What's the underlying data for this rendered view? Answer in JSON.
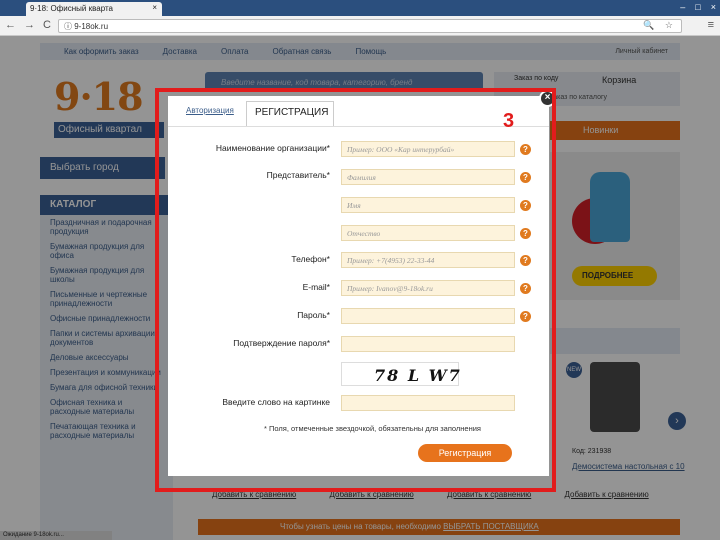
{
  "browser": {
    "tab_title": "9·18: Офисный кварта",
    "tab_close": "×",
    "window_buttons": [
      "–",
      "□",
      "×"
    ],
    "nav_icons": [
      "←",
      "→",
      "C"
    ],
    "url": "ⓘ 9-18ok.ru",
    "url_icons": "🔍 ☆",
    "menu_icon": "≡",
    "status": "Ожидание 9-18ok.ru..."
  },
  "site": {
    "topnav": [
      "Как оформить заказ",
      "Доставка",
      "Оплата",
      "Обратная связь",
      "Помощь"
    ],
    "personal_cabinet": "Личный кабинет",
    "logo": "9·18",
    "logo_sub": "Офисный квартал",
    "search_placeholder": "Введите название, код товара, категорию, бренд",
    "order_by_code": "Заказ по коду",
    "cart": "Корзина",
    "catalog_order": "Заказ по каталогу",
    "new_items": "Новинки",
    "choose_city": "Выбрать город",
    "catalog_title": "КАТАЛОГ",
    "catalog_items": [
      "Праздничная и подарочная продукция",
      "Бумажная продукция для офиса",
      "Бумажная продукция для школы",
      "Письменные и чертежные принадлежности",
      "Офисные принадлежности",
      "Папки и системы архивации документов",
      "Деловые аксессуары",
      "Презентация и коммуникации",
      "Бумага для офисной техники",
      "Офисная техника и расходные материалы",
      "Печатающая техника и расходные материалы"
    ],
    "more_button": "ПОДРОБНЕЕ",
    "new_badge": "NEW",
    "next_arrow": "›",
    "product_code": "Код: 231938",
    "product_name": "Демосистема настольная с 10",
    "compare_links": [
      "Добавить к сравнению",
      "Добавить к сравнению",
      "Добавить к сравнению",
      "Добавить к сравнению"
    ],
    "bottom_bar_text": "Чтобы узнать цены на товары, необходимо",
    "bottom_bar_link": "ВЫБРАТЬ ПОСТАВЩИКА"
  },
  "modal": {
    "tab_login": "Авторизация",
    "tab_register": "РЕГИСТРАЦИЯ",
    "close": "×",
    "labels": {
      "org": "Наименование организации*",
      "rep": "Представитель*",
      "phone": "Телефон*",
      "email": "E-mail*",
      "password": "Пароль*",
      "password_confirm": "Подтверждение пароля*",
      "captcha_word": "Введите слово на картинке"
    },
    "placeholders": {
      "org": "Пример: ООО «Кар интерурбай»",
      "surname": "Фамилия",
      "name": "Имя",
      "patronymic": "Отчество",
      "phone": "Пример: +7(4953) 22-33-44",
      "email": "Пример: Ivanov@9-18ok.ru"
    },
    "help": "?",
    "captcha_text": "78 L W7",
    "required_note": "* Поля, отмеченные звездочкой, обязательны для заполнения",
    "submit": "Регистрация"
  },
  "annotation": {
    "step": "3"
  },
  "colors": {
    "brand_blue": "#3c6196",
    "brand_orange": "#e7731c",
    "annotation_red": "#e21c1c",
    "input_bg": "#fdf3dc"
  }
}
